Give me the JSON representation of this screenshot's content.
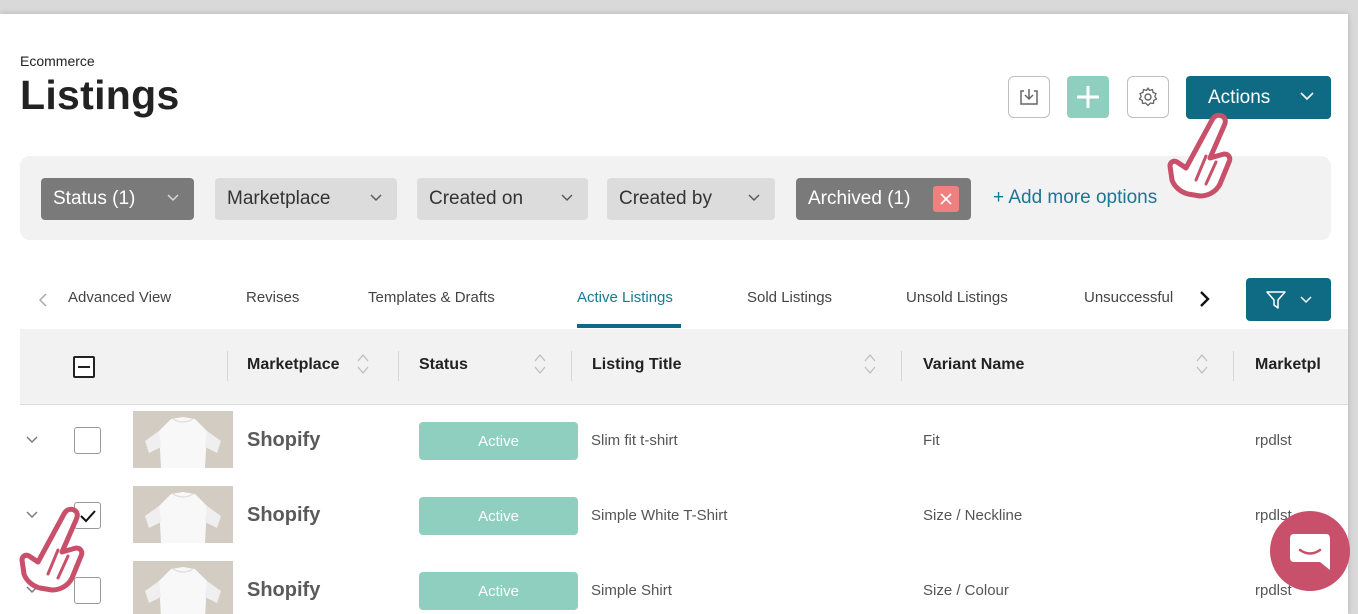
{
  "header": {
    "breadcrumb": "Ecommerce",
    "title": "Listings",
    "actions_label": "Actions",
    "icons": [
      "download-icon",
      "plus-icon",
      "gear-icon",
      "chevron-down-icon"
    ]
  },
  "filters": {
    "chips": [
      {
        "label": "Status (1)",
        "style": "dark"
      },
      {
        "label": "Marketplace",
        "style": "light"
      },
      {
        "label": "Created on",
        "style": "light"
      },
      {
        "label": "Created by",
        "style": "light"
      },
      {
        "label": "Archived (1)",
        "style": "dark",
        "removable": true
      }
    ],
    "add_more": "+ Add more options"
  },
  "tabs": [
    {
      "label": "Advanced View",
      "active": false
    },
    {
      "label": "Revises",
      "active": false
    },
    {
      "label": "Templates & Drafts",
      "active": false
    },
    {
      "label": "Active Listings",
      "active": true
    },
    {
      "label": "Sold Listings",
      "active": false
    },
    {
      "label": "Unsold Listings",
      "active": false
    },
    {
      "label": "Unsuccessful",
      "active": false
    }
  ],
  "table": {
    "columns": [
      "Marketplace",
      "Status",
      "Listing Title",
      "Variant Name",
      "Marketpl"
    ],
    "rows": [
      {
        "marketplace": "Shopify",
        "status": "Active",
        "title": "Slim fit t-shirt",
        "variant": "Fit",
        "marketplace_user": "rpdlst",
        "checked": false
      },
      {
        "marketplace": "Shopify",
        "status": "Active",
        "title": "Simple White T-Shirt",
        "variant": "Size / Neckline",
        "marketplace_user": "rpdlst",
        "checked": true
      },
      {
        "marketplace": "Shopify",
        "status": "Active",
        "title": "Simple Shirt",
        "variant": "Size / Colour",
        "marketplace_user": "rpdlst",
        "checked": false
      }
    ]
  },
  "colors": {
    "primary": "#0f6b84",
    "success": "#8ecfbf",
    "danger": "#f08080",
    "cursor": "#c8506a"
  }
}
